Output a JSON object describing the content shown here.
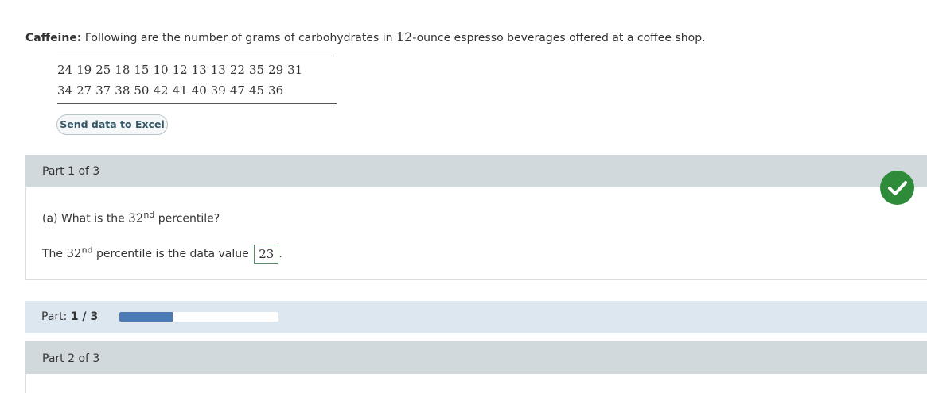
{
  "problem": {
    "topic": "Caffeine:",
    "text_before": " Following are the number of grams of carbohydrates in ",
    "number": "12",
    "text_after": "-ounce espresso beverages offered at a coffee shop."
  },
  "data": {
    "row1": [
      "24",
      "19",
      "25",
      "18",
      "15",
      "10",
      "12",
      "13",
      "13",
      "22",
      "35",
      "29",
      "31"
    ],
    "row2": [
      "34",
      "27",
      "37",
      "38",
      "50",
      "42",
      "41",
      "40",
      "39",
      "47",
      "45",
      "36"
    ]
  },
  "excel_button": "Send data to Excel",
  "part1": {
    "header": "Part 1 of 3",
    "question_prefix": "(a) What is the ",
    "question_num": "32",
    "question_sup": "nd",
    "question_suffix": " percentile?",
    "answer_prefix": "The ",
    "answer_num": "32",
    "answer_sup": "nd",
    "answer_mid": " percentile is the data value ",
    "answer_value": "23",
    "answer_end": "."
  },
  "progress": {
    "label": "Part: ",
    "current": "1",
    "separator": " / ",
    "total": "3",
    "fraction": 0.333
  },
  "part2": {
    "header": "Part 2 of 3"
  },
  "colors": {
    "check": "#2e8b3a",
    "progress_fill": "#4a7bb7"
  }
}
